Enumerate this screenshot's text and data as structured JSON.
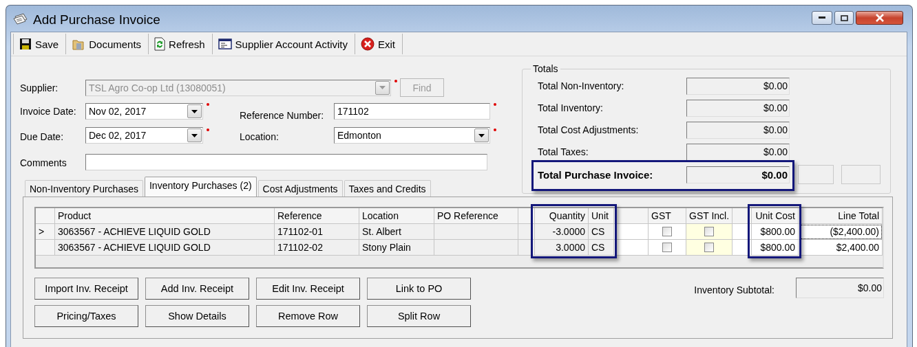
{
  "window": {
    "title": "Add Purchase Invoice"
  },
  "toolbar": [
    {
      "label": "Save",
      "kind": "save"
    },
    {
      "label": "Documents",
      "kind": "documents"
    },
    {
      "label": "Refresh",
      "kind": "refresh"
    },
    {
      "label": "Supplier Account Activity",
      "kind": "report"
    },
    {
      "label": "Exit",
      "kind": "exit"
    }
  ],
  "form": {
    "supplier": {
      "label": "Supplier:",
      "value": "TSL Agro Co-op Ltd (13080051)",
      "disabled": true,
      "required": true
    },
    "find_button": {
      "label": "Find",
      "disabled": true
    },
    "invoice_date": {
      "label": "Invoice Date:",
      "value": "Nov 02, 2017",
      "required": true
    },
    "reference_number": {
      "label": "Reference Number:",
      "value": "171102",
      "required": true
    },
    "due_date": {
      "label": "Due Date:",
      "value": "Dec 02, 2017",
      "required": true
    },
    "location": {
      "label": "Location:",
      "value": "Edmonton",
      "required": true
    },
    "comments": {
      "label": "Comments"
    }
  },
  "tabs": [
    {
      "label": "Non-Inventory Purchases",
      "selected": false
    },
    {
      "label": "Inventory Purchases (2)",
      "selected": true
    },
    {
      "label": "Cost Adjustments",
      "selected": false
    },
    {
      "label": "Taxes and Credits",
      "selected": false
    }
  ],
  "totals": {
    "title": "Totals",
    "rows": [
      {
        "label": "Total Non-Inventory:",
        "value": "$0.00",
        "kind": "subtotal"
      },
      {
        "label": "Total Inventory:",
        "value": "$0.00",
        "kind": "subtotal"
      },
      {
        "label": "Total Cost Adjustments:",
        "value": "$0.00",
        "kind": "subtotal"
      },
      {
        "label": "Total Taxes:",
        "value": "$0.00",
        "kind": "subtotal"
      },
      {
        "label": "Total Purchase Invoice:",
        "value": "$0.00",
        "kind": "grand",
        "highlighted": true
      }
    ]
  },
  "grid": {
    "columns": [
      {
        "header": "Product",
        "kind": "text",
        "color": "#f0f0f0"
      },
      {
        "header": "Reference",
        "kind": "text",
        "color": "#f0f0f0"
      },
      {
        "header": "Location",
        "kind": "text",
        "color": "#f0f0f0"
      },
      {
        "header": "PO Reference",
        "kind": "text",
        "color": "#f0f0f0"
      },
      {
        "kind": "blank",
        "color": "#f0f0f0"
      },
      {
        "header": "Quantity",
        "kind": "number",
        "color": "#f0f0f0",
        "highlighted": true
      },
      {
        "header": "Unit",
        "kind": "text",
        "color": "#f0f0f0",
        "highlighted": true
      },
      {
        "kind": "blank",
        "color": "#ffffff"
      },
      {
        "header": "GST",
        "kind": "check",
        "color": "#ffffff"
      },
      {
        "header": "GST Incl.",
        "kind": "check",
        "color": "#ffffe1"
      },
      {
        "kind": "blank",
        "color": "#ffffff"
      },
      {
        "header": "Unit Cost",
        "kind": "number",
        "color": "#ffffff",
        "highlighted": true
      },
      {
        "header": "Line Total",
        "kind": "number",
        "color": "#ffffff"
      }
    ],
    "rows": [
      {
        "marker": ">",
        "focused": true,
        "cells": [
          "3063567 - ACHIEVE LIQUID GOLD",
          "171102-01",
          "St. Albert",
          null,
          null,
          "-3.0000",
          "CS",
          null,
          {
            "checked": false
          },
          {
            "checked": false
          },
          null,
          "$800.00",
          "($2,400.00)"
        ]
      },
      {
        "focused": false,
        "cells": [
          "3063567 - ACHIEVE LIQUID GOLD",
          "171102-02",
          "Stony Plain",
          null,
          null,
          "3.0000",
          "CS",
          null,
          {
            "checked": false
          },
          {
            "checked": false
          },
          null,
          "$800.00",
          "$2,400.00"
        ]
      }
    ]
  },
  "buttons": [
    {
      "label": "Import Inv. Receipt"
    },
    {
      "label": "Add Inv. Receipt"
    },
    {
      "label": "Edit Inv. Receipt"
    },
    {
      "label": "Link to PO"
    },
    {
      "label": "Pricing/Taxes"
    },
    {
      "label": "Show Details"
    },
    {
      "label": "Remove Row"
    },
    {
      "label": "Split Row"
    }
  ],
  "inventory_subtotal": {
    "label": "Inventory Subtotal:",
    "value": "$0.00"
  }
}
